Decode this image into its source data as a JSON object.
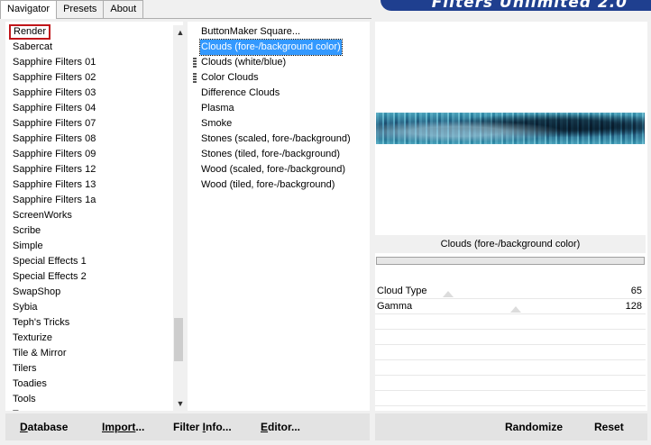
{
  "tabs": [
    {
      "label": "Navigator",
      "active": true
    },
    {
      "label": "Presets",
      "active": false
    },
    {
      "label": "About",
      "active": false
    }
  ],
  "banner": {
    "title": "Filters Unlimited 2.0",
    "color": "#1f3f8f"
  },
  "categories": {
    "items": [
      "Render",
      "Sabercat",
      "Sapphire Filters 01",
      "Sapphire Filters 02",
      "Sapphire Filters 03",
      "Sapphire Filters 04",
      "Sapphire Filters 07",
      "Sapphire Filters 08",
      "Sapphire Filters 09",
      "Sapphire Filters 12",
      "Sapphire Filters 13",
      "Sapphire Filters 1a",
      "ScreenWorks",
      "Scribe",
      "Simple",
      "Special Effects 1",
      "Special Effects 2",
      "SwapShop",
      "Sybia",
      "Teph's Tricks",
      "Texturize",
      "Tile & Mirror",
      "Tilers",
      "Toadies",
      "Tools",
      "Transparency"
    ],
    "selected": "Render"
  },
  "filters": {
    "items": [
      {
        "label": "ButtonMaker Square...",
        "grip": false
      },
      {
        "label": "Clouds (fore-/background color)",
        "grip": false
      },
      {
        "label": "Clouds (white/blue)",
        "grip": true
      },
      {
        "label": "Color Clouds",
        "grip": true
      },
      {
        "label": "Difference Clouds",
        "grip": false
      },
      {
        "label": "Plasma",
        "grip": false
      },
      {
        "label": "Smoke",
        "grip": false
      },
      {
        "label": "Stones (scaled, fore-/background)",
        "grip": false
      },
      {
        "label": "Stones (tiled, fore-/background)",
        "grip": false
      },
      {
        "label": "Wood (scaled, fore-/background)",
        "grip": false
      },
      {
        "label": "Wood (tiled, fore-/background)",
        "grip": false
      }
    ],
    "selected": "Clouds (fore-/background color)"
  },
  "preview": {
    "current_filter": "Clouds (fore-/background color)"
  },
  "parameters": [
    {
      "name": "Cloud Type",
      "value": "65"
    },
    {
      "name": "Gamma",
      "value": "128"
    }
  ],
  "bottom_left": {
    "database_first": "D",
    "database_rest": "atabase",
    "import_first": "Import",
    "import_rest": "...",
    "filter_info_first": "Filter ",
    "filter_info_mid": "I",
    "filter_info_rest": "nfo...",
    "editor_first": "E",
    "editor_rest": "ditor..."
  },
  "bottom_right": {
    "randomize": "Randomize",
    "reset": "Reset"
  }
}
